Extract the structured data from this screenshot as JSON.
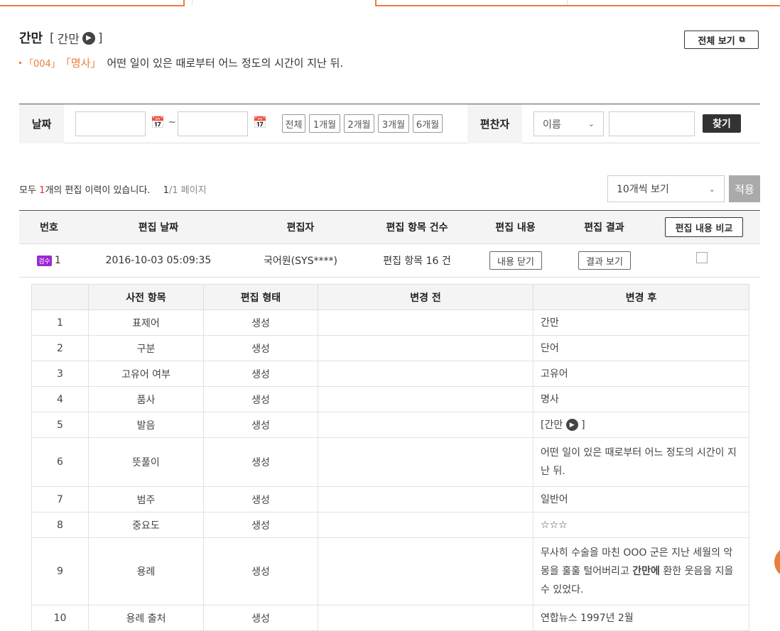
{
  "heading": {
    "word": "간만",
    "pronunciation": "간만",
    "full_view_label": "전체 보기",
    "sense_code": "「004」",
    "sense_pos": "「명사」",
    "sense_definition": "어떤 일이 있은 때로부터 어느 정도의 시간이 지난 뒤."
  },
  "filter": {
    "date_label": "날짜",
    "tilde": "~",
    "ranges": [
      "전체",
      "1개월",
      "2개월",
      "3개월",
      "6개월"
    ],
    "editor_label": "편찬자",
    "editor_select": "이름",
    "search_label": "찾기"
  },
  "summary": {
    "prefix": "모두 ",
    "count": "1",
    "suffix": "개의 편집 이력이 있습니다.",
    "page_current": "1",
    "page_total": "/1 페이지",
    "per_page": "10개씩 보기",
    "apply_label": "적용"
  },
  "history_table": {
    "headers": [
      "번호",
      "편집 날짜",
      "편집자",
      "편집 항목 건수",
      "편집 내용",
      "편집 결과"
    ],
    "compare_label": "편집 내용 비교",
    "row": {
      "badge": "검수",
      "number": "1",
      "date": "2016-10-03 05:09:35",
      "editor": "국어원(SYS****)",
      "count": "편집 항목 16 건",
      "content_btn": "내용 닫기",
      "result_btn": "결과 보기"
    }
  },
  "detail_table": {
    "headers": [
      "",
      "사전 항목",
      "편집 형태",
      "변경 전",
      "변경 후"
    ],
    "rows": [
      {
        "no": "1",
        "item": "표제어",
        "type": "생성",
        "before": "",
        "after": "간만"
      },
      {
        "no": "2",
        "item": "구분",
        "type": "생성",
        "before": "",
        "after": "단어"
      },
      {
        "no": "3",
        "item": "고유어 여부",
        "type": "생성",
        "before": "",
        "after": "고유어"
      },
      {
        "no": "4",
        "item": "품사",
        "type": "생성",
        "before": "",
        "after": "명사"
      },
      {
        "no": "5",
        "item": "발음",
        "type": "생성",
        "before": "",
        "after": "간만"
      },
      {
        "no": "6",
        "item": "뜻풀이",
        "type": "생성",
        "before": "",
        "after": "어떤 일이 있은 때로부터 어느 정도의 시간이 지난 뒤."
      },
      {
        "no": "7",
        "item": "범주",
        "type": "생성",
        "before": "",
        "after": "일반어"
      },
      {
        "no": "8",
        "item": "중요도",
        "type": "생성",
        "before": "",
        "after": "☆☆☆"
      },
      {
        "no": "9",
        "item": "용례",
        "type": "생성",
        "before": "",
        "after_pre": "무사히 수술을 마친 OOO 군은 지난 세월의 악몽을 훌훌 털어버리고 ",
        "after_bold": "간만에",
        "after_post": " 환한 웃음을 지을 수 있었다."
      },
      {
        "no": "10",
        "item": "용례 출처",
        "type": "생성",
        "before": "",
        "after": "연합뉴스 1997년 2월"
      }
    ]
  }
}
